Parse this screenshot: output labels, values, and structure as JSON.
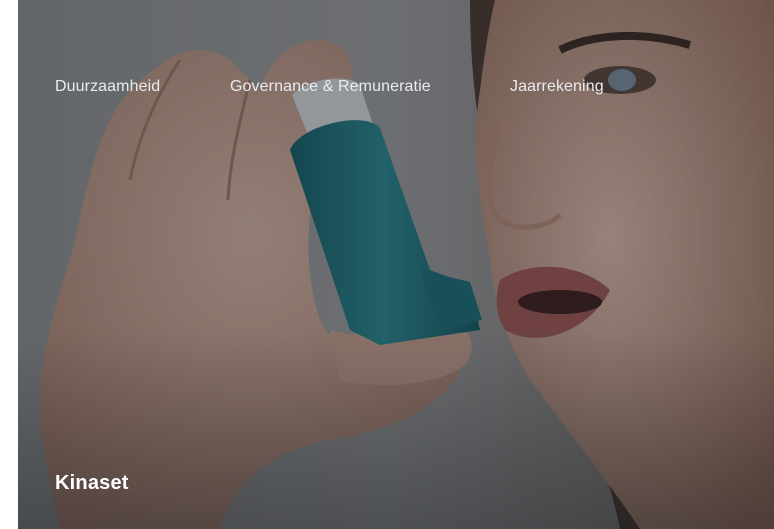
{
  "nav": {
    "items": [
      {
        "label": "Duurzaamheid"
      },
      {
        "label": "Governance & Remuneratie"
      },
      {
        "label": "Jaarrekening"
      }
    ]
  },
  "hero": {
    "image_description_icon": "person-using-inhaler-photo",
    "title": "Kinaset"
  },
  "colors": {
    "text": "#e9ebee",
    "title": "#ffffff",
    "inhaler": "#1d6e7a",
    "overlay": "rgba(20,22,26,0.35)"
  }
}
